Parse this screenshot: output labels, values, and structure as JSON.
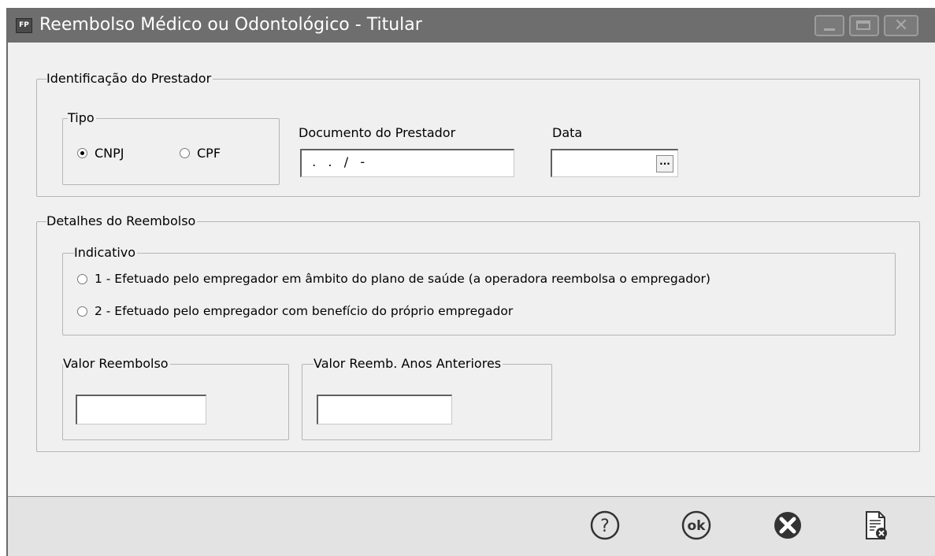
{
  "window": {
    "app_icon": "FP",
    "title": "Reembolso Médico ou Odontológico - Titular",
    "controls": [
      "minimize-icon",
      "maximize-icon",
      "close-icon"
    ]
  },
  "prestador": {
    "legend": "Identificação do Prestador",
    "tipo_legend": "Tipo",
    "cnpj_label": "CNPJ",
    "cpf_label": "CPF",
    "selected": "CNPJ",
    "documento_label": "Documento do Prestador",
    "documento_value": " .   .   /   -",
    "data_label": "Data",
    "data_value": "",
    "date_picker_button": "...",
    "date_picker_icon": "ellipsis-icon"
  },
  "reembolso": {
    "legend": "Detalhes do Reembolso",
    "indicativo_legend": "Indicativo",
    "option1": "1 - Efetuado pelo empregador em âmbito do plano de saúde (a operadora reembolsa o empregador)",
    "option2": "2 - Efetuado pelo empregador com benefício do próprio empregador",
    "valor_legend": "Valor Reembolso",
    "valor_value": "",
    "anteriores_legend": "Valor Reemb. Anos Anteriores",
    "anteriores_value": ""
  },
  "footer": {
    "buttons": [
      "help-icon",
      "ok-icon",
      "cancel-icon",
      "report-icon"
    ],
    "ok_text": "ok",
    "help_text": "?"
  },
  "colors": {
    "titlebar": "#6e6e6e",
    "dialog_bg": "#f0f0f0",
    "footer_bg": "#e3e3e3",
    "icon": "#333333"
  }
}
